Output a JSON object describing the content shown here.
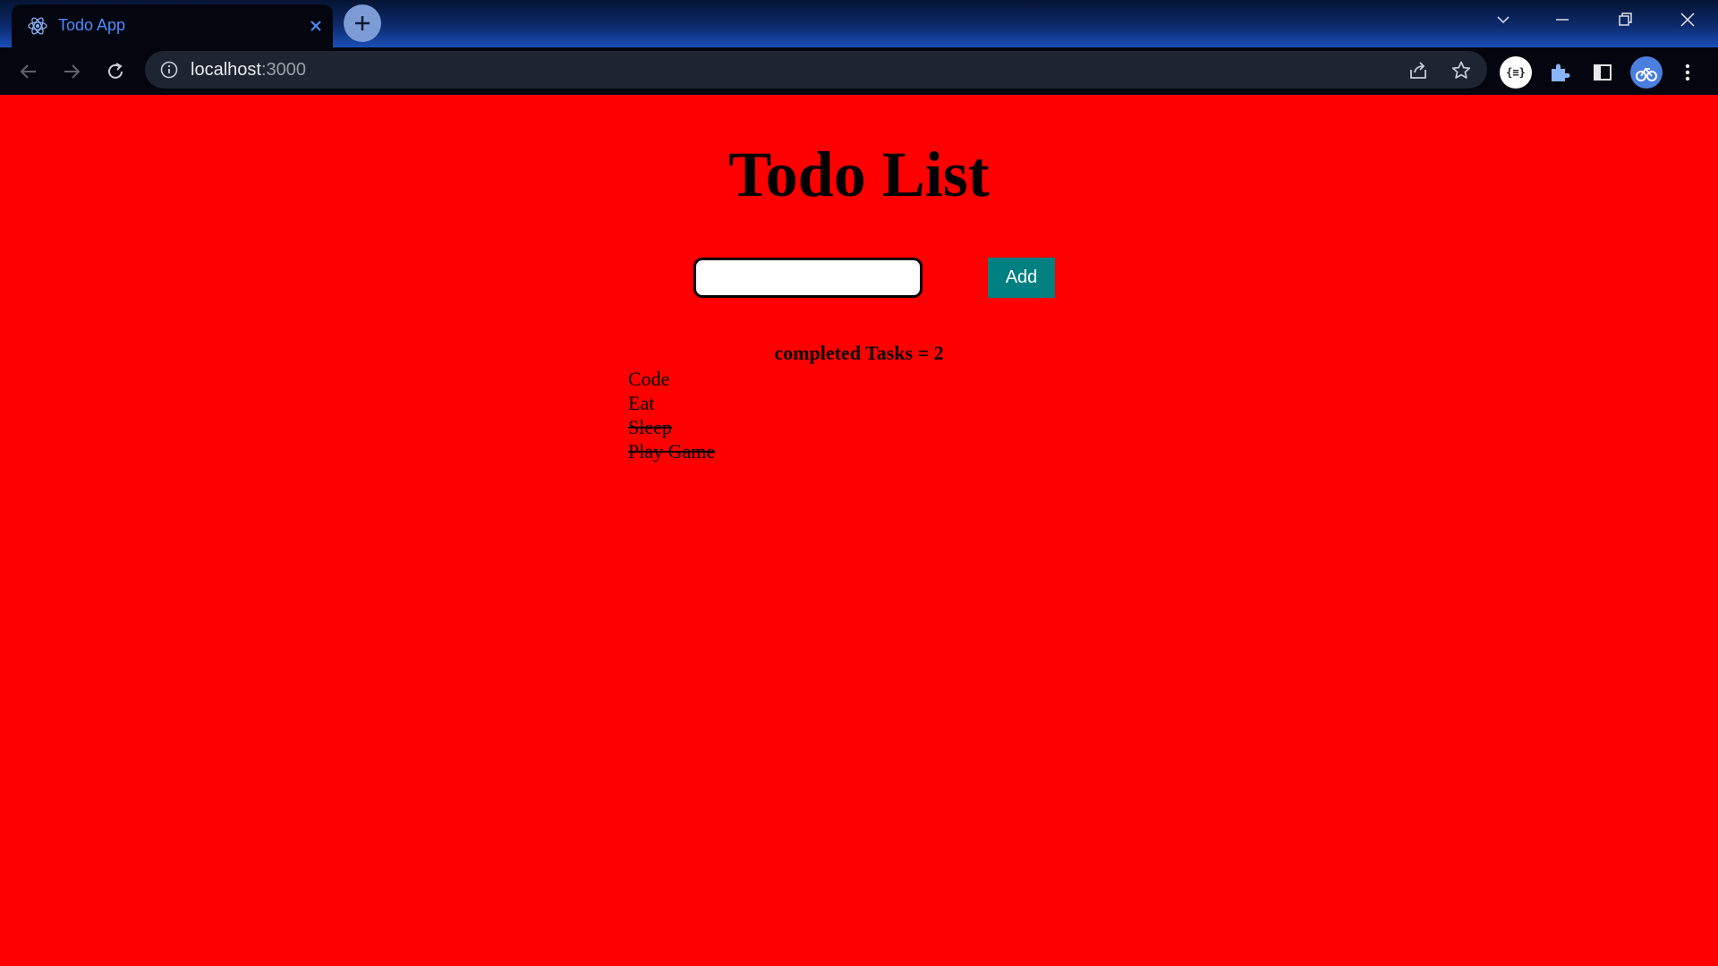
{
  "browser": {
    "tab_title": "Todo App",
    "url_host": "localhost",
    "url_port": ":3000",
    "ext_json_label": "{≡}"
  },
  "app": {
    "title": "Todo List",
    "input_value": "",
    "add_label": "Add",
    "completed_text": "completed Tasks = 2",
    "todos": [
      {
        "text": "Code",
        "completed": false
      },
      {
        "text": "Eat",
        "completed": false
      },
      {
        "text": "Sleep",
        "completed": true
      },
      {
        "text": "Play Game",
        "completed": true
      }
    ]
  },
  "colors": {
    "page_background": "#ff0000",
    "add_button": "#008080",
    "tab_title": "#4d8cff"
  }
}
